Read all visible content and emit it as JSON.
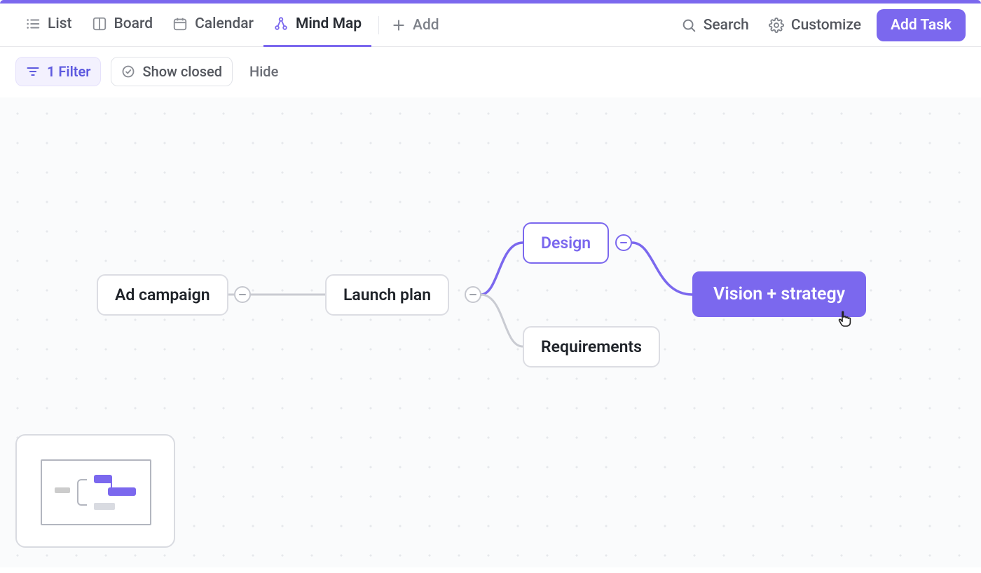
{
  "views": {
    "list": "List",
    "board": "Board",
    "calendar": "Calendar",
    "mindmap": "Mind Map",
    "add": "Add"
  },
  "header": {
    "search": "Search",
    "customize": "Customize",
    "add_task": "Add Task"
  },
  "filters": {
    "filter_label": "1 Filter",
    "show_closed": "Show closed",
    "hide": "Hide"
  },
  "nodes": {
    "ad_campaign": "Ad campaign",
    "launch_plan": "Launch plan",
    "design": "Design",
    "requirements": "Requirements",
    "vision_strategy": "Vision + strategy"
  }
}
